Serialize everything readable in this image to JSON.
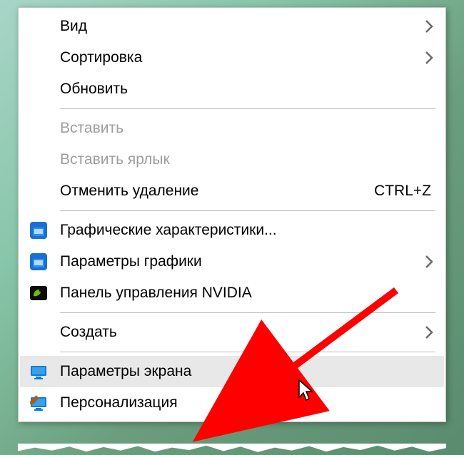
{
  "context_menu": {
    "items": [
      {
        "label": "Вид",
        "has_submenu": true
      },
      {
        "label": "Сортировка",
        "has_submenu": true
      },
      {
        "label": "Обновить"
      }
    ],
    "paste_items": [
      {
        "label": "Вставить",
        "disabled": true
      },
      {
        "label": "Вставить ярлык",
        "disabled": true
      },
      {
        "label": "Отменить удаление",
        "shortcut": "CTRL+Z"
      }
    ],
    "app_items": [
      {
        "label": "Графические характеристики...",
        "icon": "intel-graphics-icon"
      },
      {
        "label": "Параметры графики",
        "icon": "intel-graphics-icon",
        "has_submenu": true
      },
      {
        "label": "Панель управления NVIDIA",
        "icon": "nvidia-icon"
      }
    ],
    "create_items": [
      {
        "label": "Создать",
        "has_submenu": true
      }
    ],
    "settings_items": [
      {
        "label": "Параметры экрана",
        "icon": "display-icon",
        "hovered": true
      },
      {
        "label": "Персонализация",
        "icon": "personalize-icon"
      }
    ]
  },
  "annotation": {
    "highlighted_item": "Параметры экрана",
    "arrow_color": "#ff0000"
  }
}
